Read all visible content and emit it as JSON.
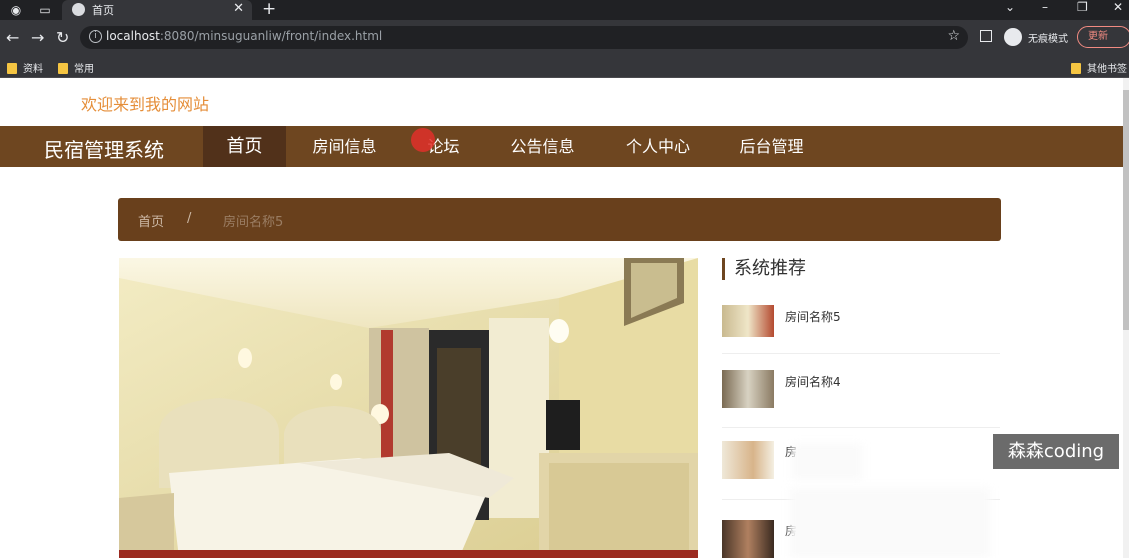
{
  "browser": {
    "tab_title": "首页",
    "url_host": "localhost",
    "url_rest": ":8080/minsuguanliw/front/index.html",
    "incognito_label": "无痕模式",
    "update_label": "更新",
    "bookmarks": [
      "资料",
      "常用"
    ],
    "other_bookmarks": "其他书签"
  },
  "site": {
    "welcome": "欢迎来到我的网站",
    "brand": "民宿管理系统",
    "menu": [
      "首页",
      "房间信息",
      "论坛",
      "公告信息",
      "个人中心",
      "后台管理"
    ],
    "active_menu": "首页"
  },
  "breadcrumb": {
    "home": "首页",
    "separator": "/",
    "current": "房间名称5"
  },
  "sidebar": {
    "title": "系统推荐",
    "items": [
      {
        "name": "房间名称5"
      },
      {
        "name": "房间名称4"
      },
      {
        "name": "房"
      },
      {
        "name": "房"
      }
    ]
  },
  "watermark": "森森coding",
  "colors": {
    "nav_brown": "#6e4620",
    "nav_active": "#51311a",
    "welcome_orange": "#e58e39",
    "breadcrumb_bg": "#69401c"
  }
}
